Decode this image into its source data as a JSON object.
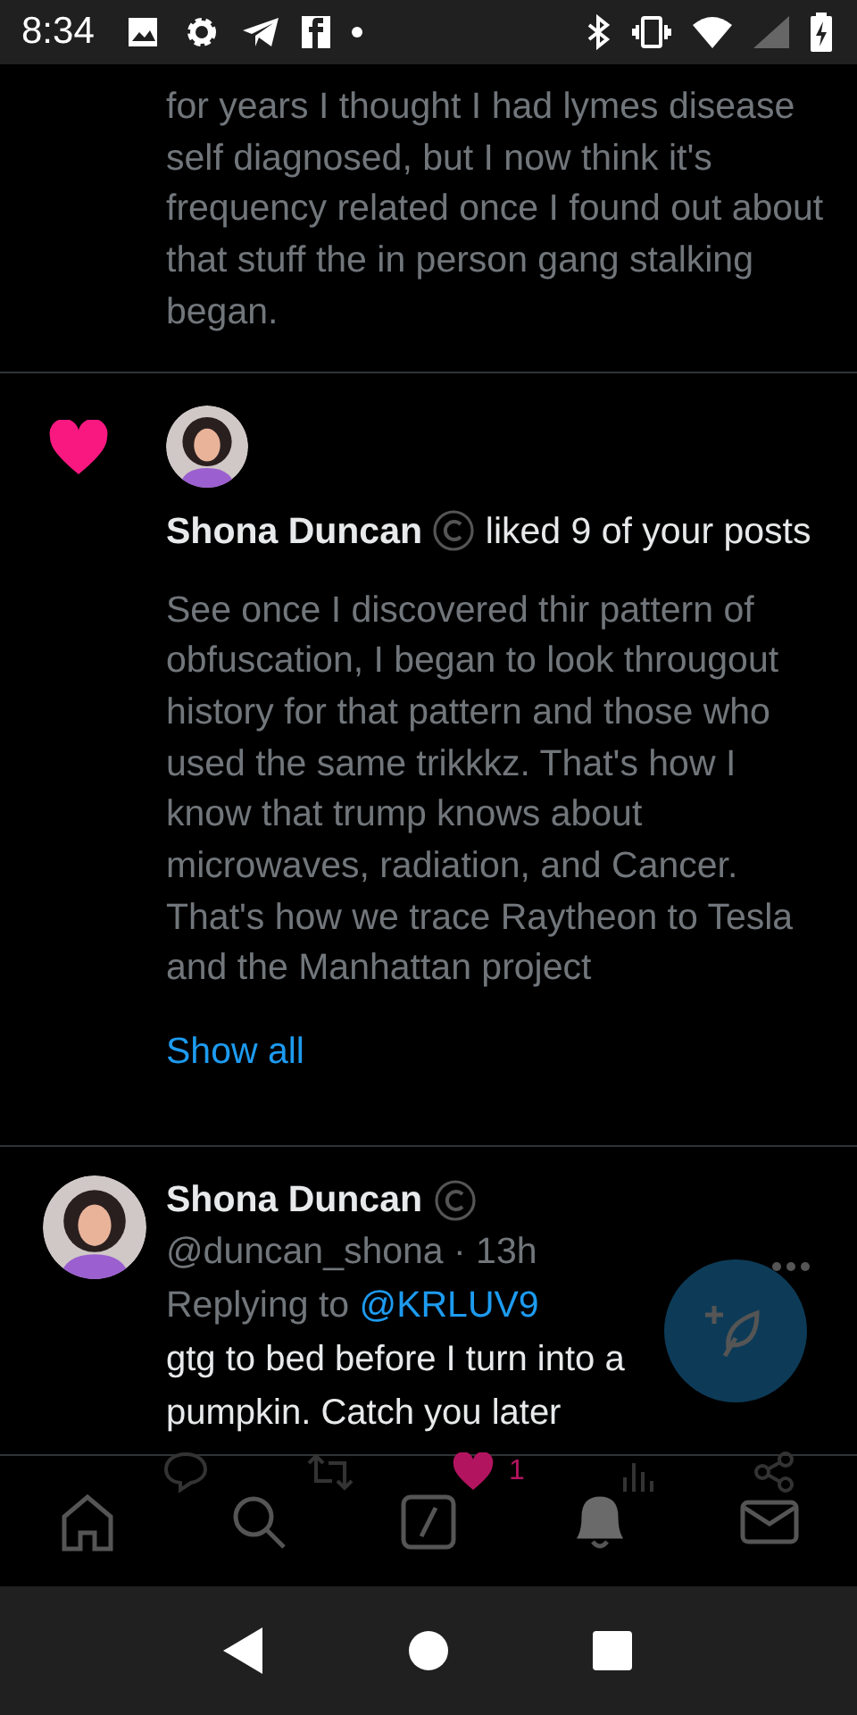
{
  "status_bar": {
    "time": "8:34"
  },
  "previous_post": {
    "text": "for years I thought I had lymes disease self diagnosed, but I now think it's frequency related once I found out about that stuff the in person gang stalking began."
  },
  "notification": {
    "kind": "like",
    "user": "Shona Duncan",
    "action": "liked 9 of your posts",
    "post_text": "See once I discovered thir pattern of obfuscation, I began to look througout history for that pattern and those who used the same trikkkz. That's how I know that trump knows about microwaves, radiation, and Cancer. That's how we trace Raytheon to Tesla and the Manhattan project",
    "show_all": "Show all"
  },
  "tweet": {
    "name": "Shona Duncan",
    "handle": "@duncan_shona",
    "separator": "·",
    "time": "13h",
    "replying_label": "Replying to",
    "replying_to": "@KRLUV9",
    "text": "gtg to bed before I turn into a pumpkin.  Catch you later",
    "liked": true,
    "like_count": "1"
  },
  "bottom_nav": [
    {
      "kind": "home",
      "selected": false
    },
    {
      "kind": "search",
      "selected": false
    },
    {
      "kind": "spaces",
      "selected": false
    },
    {
      "kind": "notifications",
      "selected": true
    },
    {
      "kind": "messages",
      "selected": false
    }
  ]
}
